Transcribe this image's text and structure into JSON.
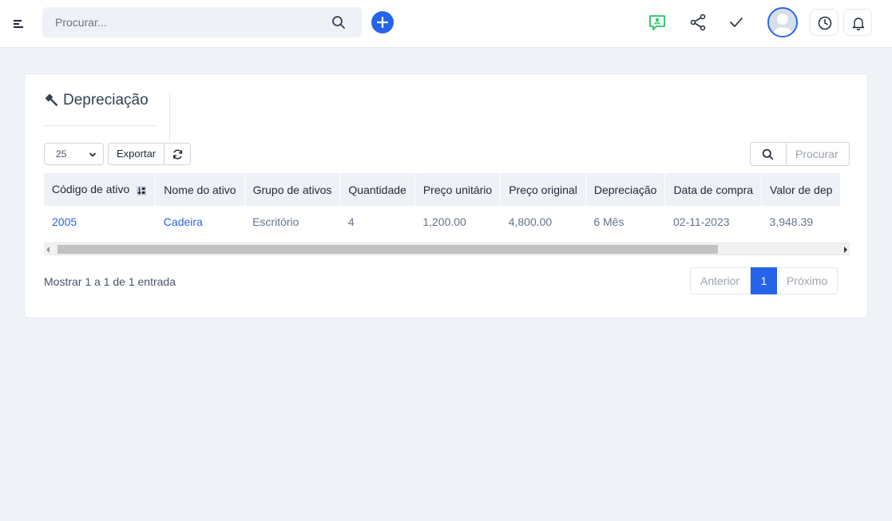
{
  "header": {
    "search_placeholder": "Procurar...",
    "icons": [
      "menu-toggle-icon",
      "search-icon",
      "plus-icon",
      "chat-support-icon",
      "share-icon",
      "check-icon",
      "avatar",
      "clock-icon",
      "bell-icon"
    ],
    "accent_color": "#2563eb",
    "support_color": "#22c55e"
  },
  "panel": {
    "title": "Depreciação",
    "title_icon": "gavel-icon",
    "page_length": "25",
    "export_label": "Exportar",
    "search_placeholder": "Procurar"
  },
  "table": {
    "columns": [
      "Código de ativo",
      "Nome do ativo",
      "Grupo de ativos",
      "Quantidade",
      "Preço unitário",
      "Preço original",
      "Depreciação",
      "Data de compra",
      "Valor de dep"
    ],
    "rows": [
      [
        "2005",
        "Cadeira",
        "Escritório",
        "4",
        "1,200.00",
        "4,800.00",
        "6 Mês",
        "02-11-2023",
        "3,948.39"
      ]
    ]
  },
  "footer": {
    "info": "Mostrar 1 a 1 de 1 entrada",
    "prev": "Anterior",
    "current_page": "1",
    "next": "Próximo"
  }
}
